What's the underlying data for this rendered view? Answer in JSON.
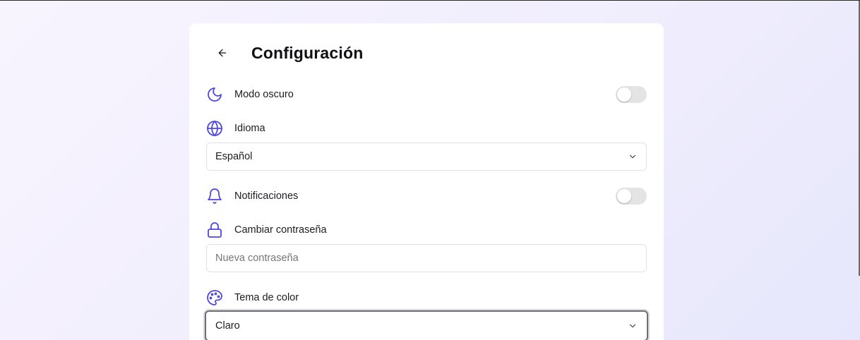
{
  "header": {
    "title": "Configuración",
    "back_icon": "arrow-left-icon"
  },
  "settings": {
    "dark_mode": {
      "label": "Modo oscuro",
      "icon": "moon-icon",
      "enabled": false
    },
    "language": {
      "label": "Idioma",
      "icon": "globe-icon",
      "selected": "Español"
    },
    "notifications": {
      "label": "Notificaciones",
      "icon": "bell-icon",
      "enabled": false
    },
    "password": {
      "label": "Cambiar contraseña",
      "icon": "lock-icon",
      "placeholder": "Nueva contraseña",
      "value": ""
    },
    "theme": {
      "label": "Tema de color",
      "icon": "palette-icon",
      "selected": "Claro"
    }
  },
  "colors": {
    "accent": "#4f46e5",
    "toggle_off": "#e4e4e7",
    "title": "#0f0f14"
  }
}
